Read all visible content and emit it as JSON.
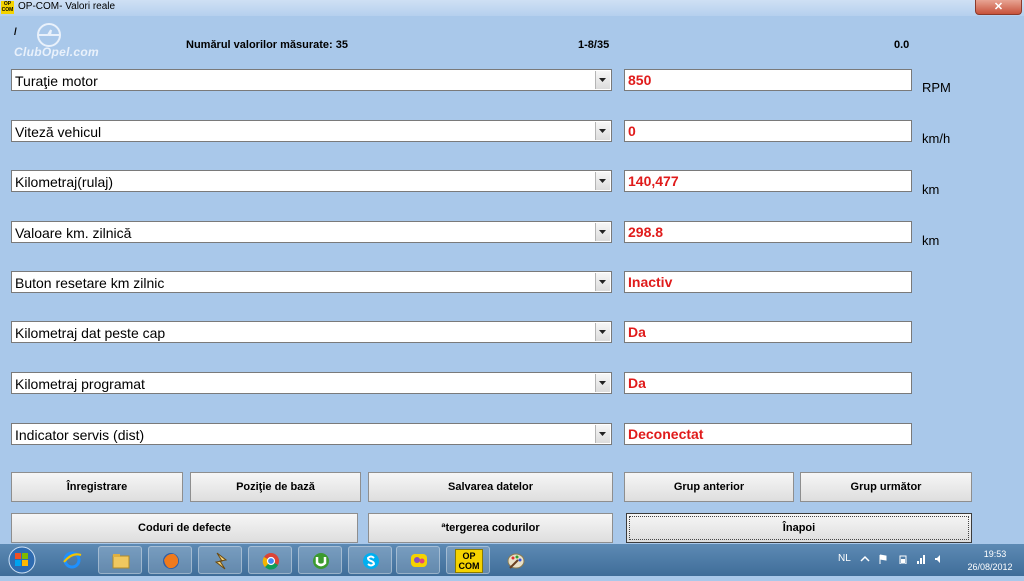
{
  "window": {
    "app_icon_text": "OP COM",
    "title": "OP-COM- Valori reale",
    "close_glyph": "✕"
  },
  "header": {
    "slash": "/",
    "watermark": "ClubOpel.com",
    "count_label": "Numărul valorilor măsurate: 35",
    "page_label": "1-8/35",
    "time_label": "0.0"
  },
  "rows": [
    {
      "param": "Turaţie motor",
      "value": "850",
      "unit": "RPM"
    },
    {
      "param": "Viteză vehicul",
      "value": "0",
      "unit": "km/h"
    },
    {
      "param": "Kilometraj(rulaj)",
      "value": "140,477",
      "unit": "km"
    },
    {
      "param": "Valoare km. zilnică",
      "value": "298.8",
      "unit": "km"
    },
    {
      "param": "Buton  resetare km zilnic",
      "value": "Inactiv",
      "unit": ""
    },
    {
      "param": "Kilometraj dat peste cap",
      "value": "Da",
      "unit": ""
    },
    {
      "param": "Kilometraj programat",
      "value": "Da",
      "unit": ""
    },
    {
      "param": "Indicator servis (dist)",
      "value": "Deconectat",
      "unit": ""
    }
  ],
  "buttons": {
    "record": "Înregistrare",
    "base_position": "Poziţie de bază",
    "save_data": "Salvarea datelor",
    "prev_group": "Grup anterior",
    "next_group": "Grup următor",
    "fault_codes": "Coduri de defecte",
    "clear_codes": "ªtergerea codurilor",
    "back": "Înapoi"
  },
  "taskbar": {
    "icons": [
      "start-orb-icon",
      "internet-explorer-icon",
      "file-explorer-icon",
      "firefox-icon",
      "winamp-icon",
      "chrome-icon",
      "utorrent-icon",
      "skype-icon",
      "messenger-icon",
      "opcom-icon",
      "paint-icon"
    ],
    "opcom_label": "OP COM",
    "language": "NL",
    "time": "19:53",
    "date": "26/08/2012"
  },
  "colors": {
    "background": "#a9c8ea",
    "value_text": "#e01b1b",
    "taskbar": "#4a78a6"
  }
}
